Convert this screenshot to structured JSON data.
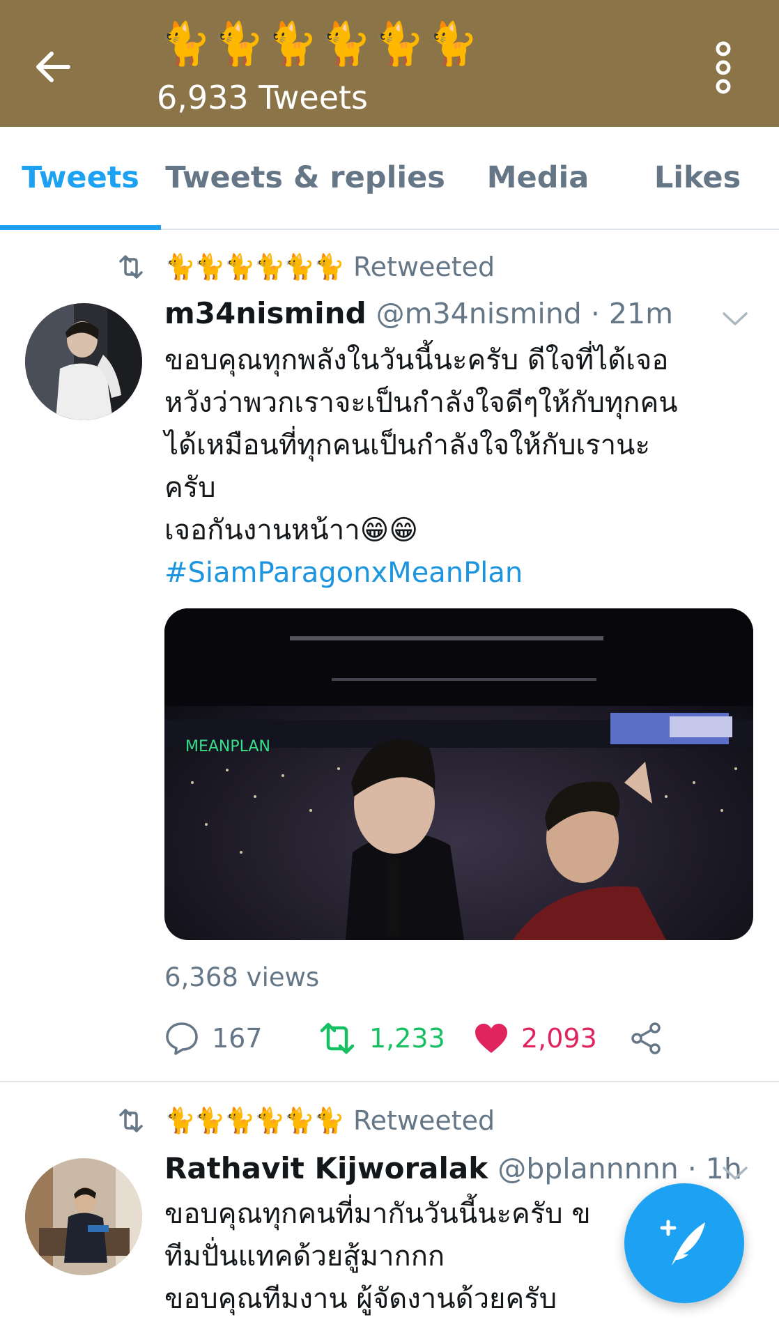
{
  "header": {
    "title": "🐈🐈🐈🐈🐈🐈",
    "subtitle": "6,933 Tweets",
    "back_icon": "arrow-left-icon",
    "more_icon": "more-vertical-icon",
    "background_color": "#8b7448"
  },
  "tabs": [
    {
      "label": "Tweets",
      "active": true
    },
    {
      "label": "Tweets & replies",
      "active": false
    },
    {
      "label": "Media",
      "active": false
    },
    {
      "label": "Likes",
      "active": false
    }
  ],
  "tweets": [
    {
      "retweeted_by": "🐈🐈🐈🐈🐈🐈",
      "retweeted_label": "Retweeted",
      "name": "m34nismind",
      "handle": "@m34nismind · 21m",
      "lines": [
        "ขอบคุณทุกพลังในวันนี้นะครับ ดีใจที่ได้เจอ",
        "หวังว่าพวกเราจะเป็นกำลังใจดีๆให้กับทุกคน",
        "ได้เหมือนที่ทุกคนเป็นกำลังใจให้กับเรานะ",
        "ครับ",
        "เจอกันงานหน้าา😁😁"
      ],
      "hashtag": "#SiamParagonxMeanPlan",
      "views": "6,368 views",
      "replies": "167",
      "retweets": "1,233",
      "likes": "2,093"
    },
    {
      "retweeted_by": "🐈🐈🐈🐈🐈🐈",
      "retweeted_label": "Retweeted",
      "name": "Rathavit Kijworalak",
      "handle": "@bplannnnn · 1h",
      "lines": [
        "ขอบคุณทุกคนที่มากันวันนี้นะครับ ข",
        "ทีมปั่นแทคด้วยสู้มากกก",
        "ขอบคุณทีมงาน ผู้จัดงานด้วยครับ"
      ]
    }
  ],
  "colors": {
    "accent": "#1da1f2",
    "retweet_green": "#17bf63",
    "like_red": "#e0245e",
    "secondary_text": "#657786"
  },
  "fab": {
    "icon": "compose-tweet-icon"
  }
}
